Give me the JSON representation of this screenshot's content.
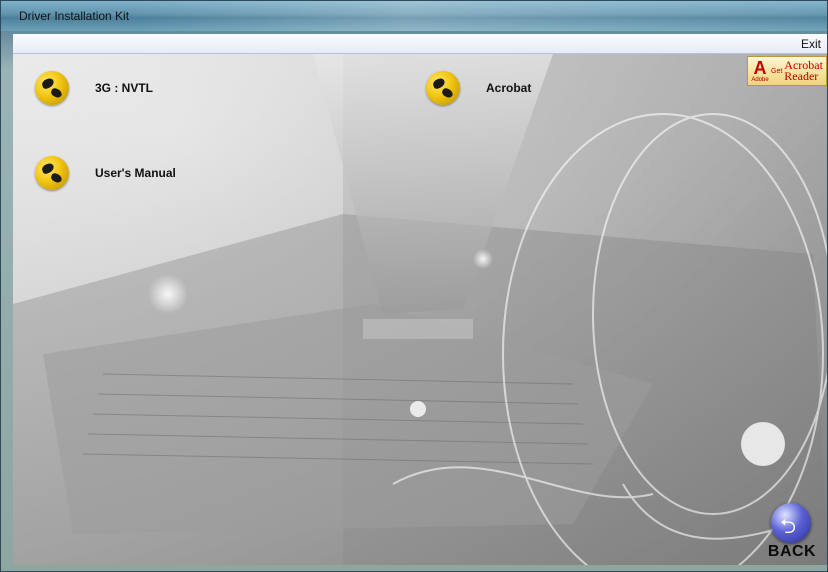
{
  "window": {
    "title": "Driver Installation Kit"
  },
  "menubar": {
    "exit_label": "Exit"
  },
  "items": [
    {
      "label": "3G : NVTL"
    },
    {
      "label": "User's Manual"
    },
    {
      "label": "Acrobat"
    }
  ],
  "acrobat_badge": {
    "adobe": "Adobe",
    "get": "Get",
    "line1": "Acrobat",
    "line2": "Reader"
  },
  "back_button": {
    "label": "BACK"
  }
}
